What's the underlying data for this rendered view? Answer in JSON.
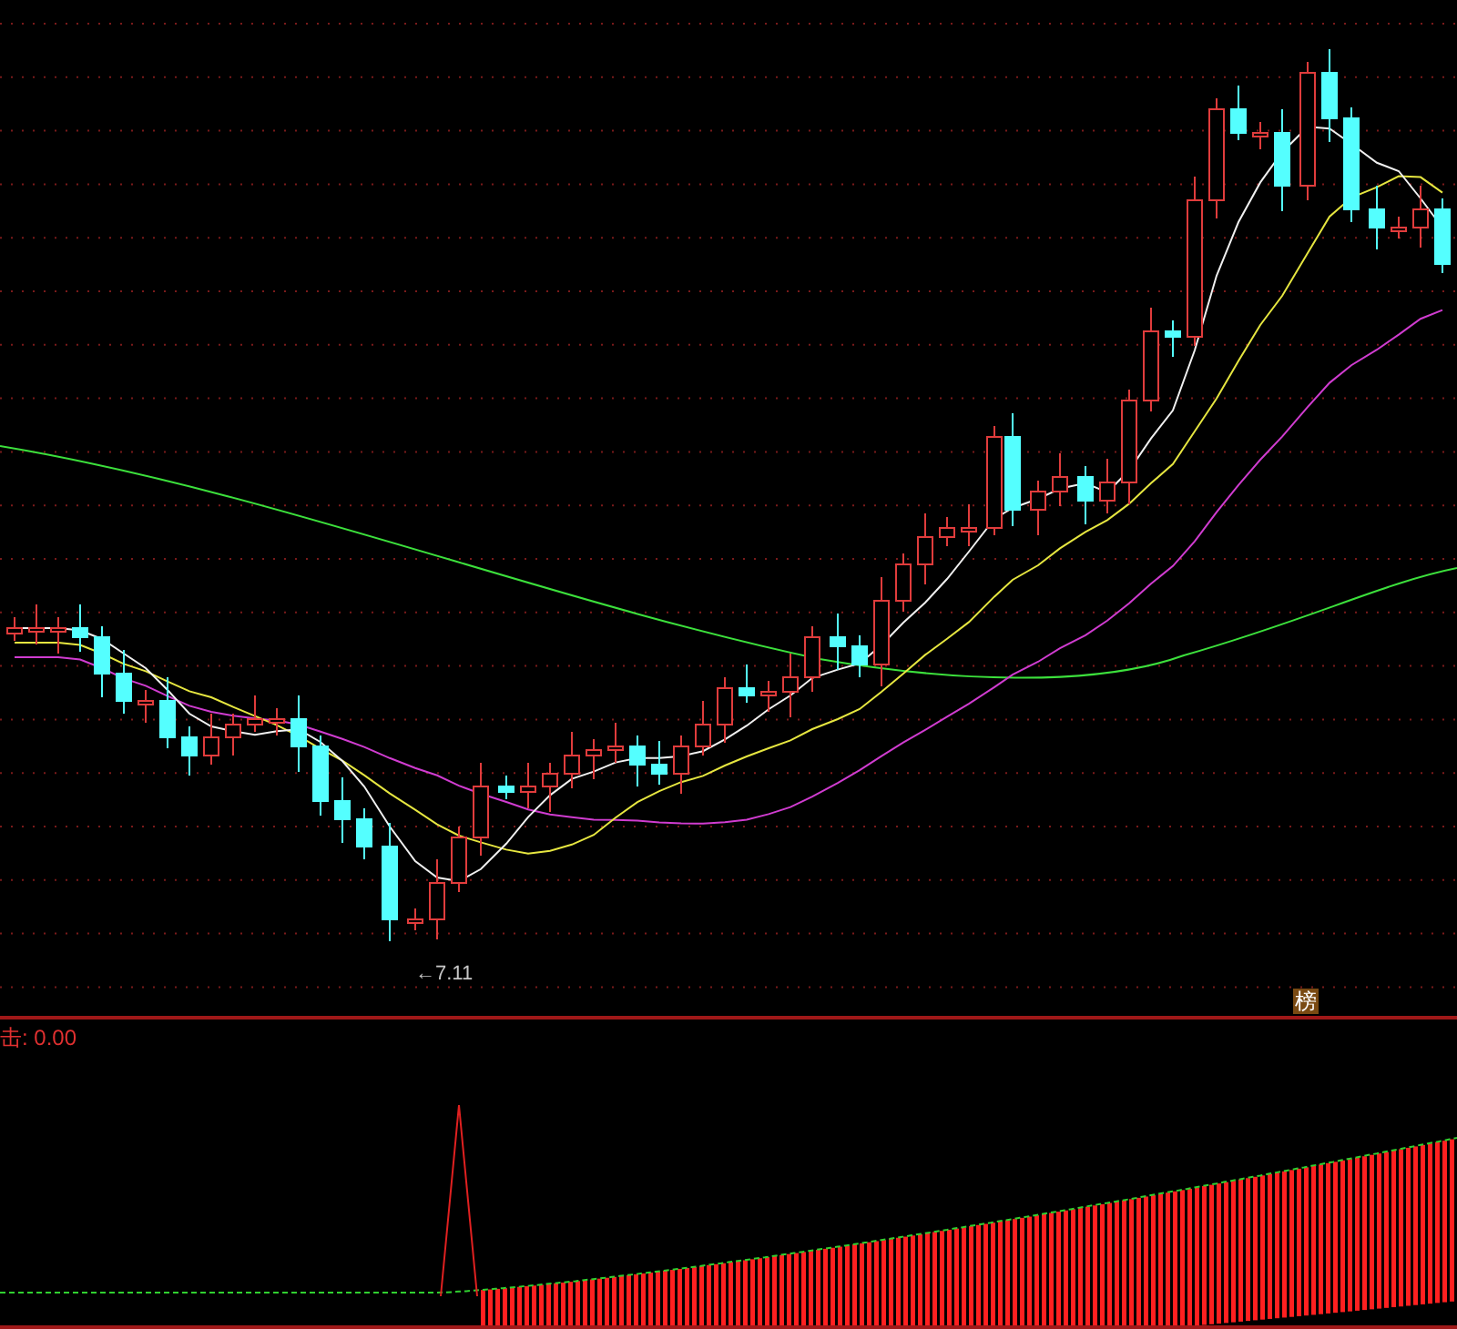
{
  "price_panel": {
    "low_marker": "←7.11",
    "badge": "榜"
  },
  "indicator_panel": {
    "legend": "击: 0.00"
  }
}
